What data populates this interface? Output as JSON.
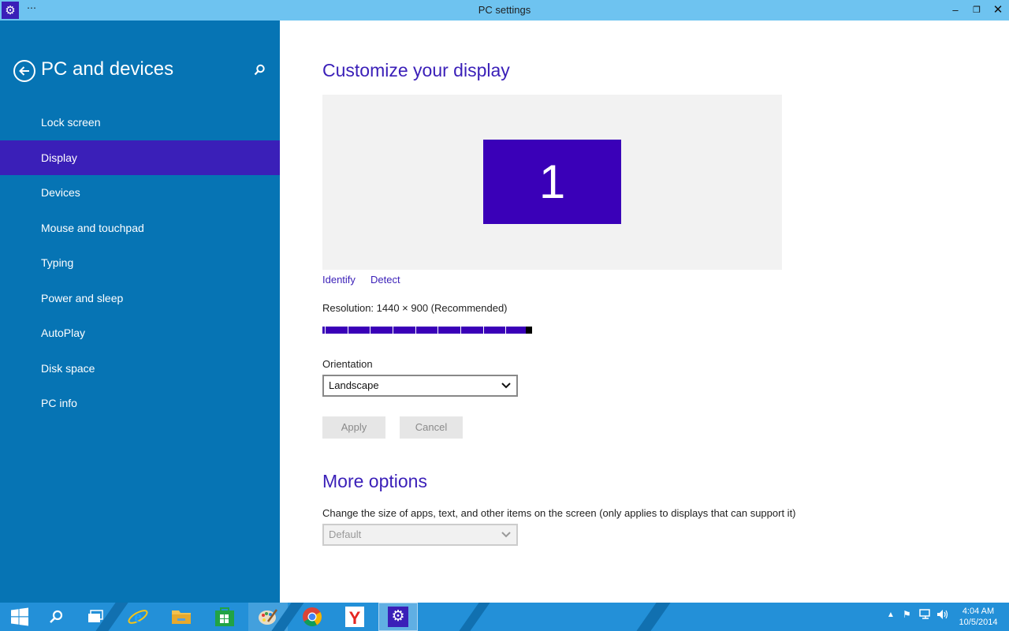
{
  "window": {
    "title": "PC settings",
    "menu_glyph": "⋯",
    "controls": {
      "minimize": "‒",
      "maximize": "❐",
      "close": "✕"
    }
  },
  "sidebar": {
    "title": "PC and devices",
    "items": [
      {
        "label": "Lock screen",
        "active": false
      },
      {
        "label": "Display",
        "active": true
      },
      {
        "label": "Devices",
        "active": false
      },
      {
        "label": "Mouse and touchpad",
        "active": false
      },
      {
        "label": "Typing",
        "active": false
      },
      {
        "label": "Power and sleep",
        "active": false
      },
      {
        "label": "AutoPlay",
        "active": false
      },
      {
        "label": "Disk space",
        "active": false
      },
      {
        "label": "PC info",
        "active": false
      }
    ]
  },
  "main": {
    "heading": "Customize your display",
    "monitor_number": "1",
    "identify_label": "Identify",
    "detect_label": "Detect",
    "resolution_label": "Resolution: 1440 × 900 (Recommended)",
    "resolution_slider_fraction": 1.0,
    "orientation_label": "Orientation",
    "orientation_value": "Landscape",
    "apply_label": "Apply",
    "cancel_label": "Cancel",
    "more_options_heading": "More options",
    "size_description": "Change the size of apps, text, and other items on the screen (only applies to displays that can support it)",
    "size_value": "Default"
  },
  "taskbar": {
    "apps": [
      "start-icon",
      "search-icon",
      "task-view-icon",
      "internet-explorer-icon",
      "file-explorer-icon",
      "store-icon",
      "paint-icon",
      "chrome-icon",
      "yandex-icon",
      "pc-settings-icon"
    ],
    "clock_time": "4:04 AM",
    "clock_date": "10/5/2014"
  },
  "colors": {
    "accent": "#3a1fb8",
    "sidebar_bg": "#0674b4",
    "titlebar_bg": "#6ec3f0",
    "taskbar_bg": "#2390d8"
  }
}
